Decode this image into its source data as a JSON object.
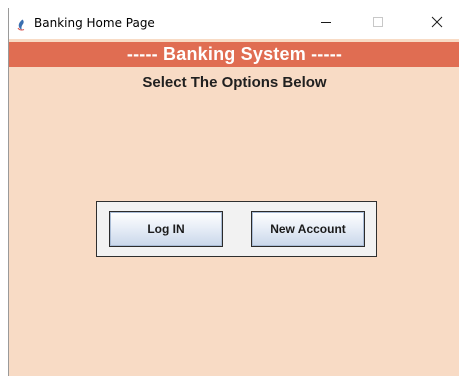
{
  "window": {
    "title": "Banking Home Page",
    "controls": {
      "minimize_icon": "minimize-icon",
      "maximize_icon": "maximize-icon",
      "close_icon": "close-icon"
    }
  },
  "header": {
    "title": "----- Banking System -----",
    "background_color": "#e06d52",
    "text_color": "#ffffff"
  },
  "main": {
    "subtitle": "Select The Options Below",
    "background_color": "#f8dbc5",
    "buttons": {
      "login_label": "Log IN",
      "new_account_label": "New Account"
    }
  }
}
